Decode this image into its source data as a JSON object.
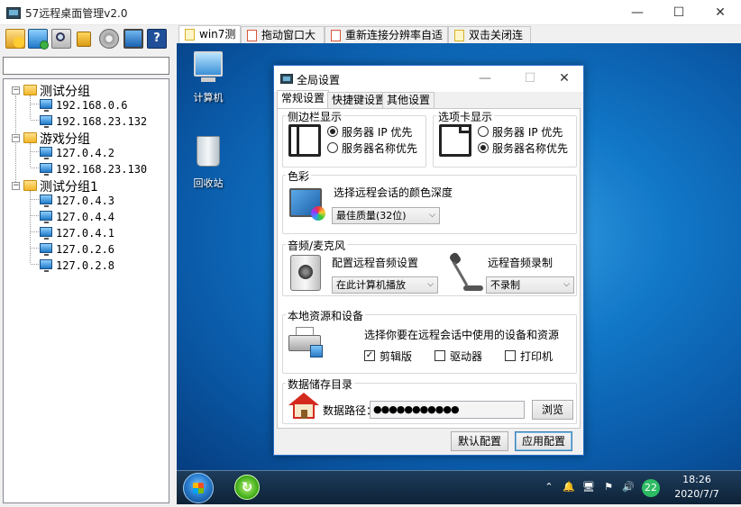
{
  "window": {
    "title": "57远程桌面管理v2.0",
    "min_glyph": "—",
    "max_glyph": "☐",
    "close_glyph": "✕"
  },
  "toolbar": {
    "icons": [
      "add-group-icon",
      "add-host-icon",
      "search-host-icon",
      "lock-icon",
      "settings-icon",
      "fullscreen-icon",
      "help-icon"
    ],
    "help_glyph": "?"
  },
  "search": {
    "value": ""
  },
  "tree": {
    "groups": [
      {
        "name": "测试分组",
        "hosts": [
          "192.168.0.6",
          "192.168.23.132"
        ]
      },
      {
        "name": "游戏分组",
        "hosts": [
          "127.0.4.2",
          "192.168.23.130"
        ]
      },
      {
        "name": "测试分组1",
        "hosts": [
          "127.0.4.3",
          "127.0.4.4",
          "127.0.4.1",
          "127.0.2.6",
          "127.0.2.8"
        ]
      }
    ],
    "expander_glyph": "−"
  },
  "tabs": [
    {
      "label": "win7测试",
      "active": true
    },
    {
      "label": "拖动窗口大小",
      "active": false
    },
    {
      "label": "重新连接分辨率自适应",
      "active": false
    },
    {
      "label": "双击关闭连接",
      "active": false
    }
  ],
  "desktop": {
    "icons": [
      {
        "label": "计算机",
        "icon": "computer-icon"
      },
      {
        "label": "回收站",
        "icon": "recycle-bin-icon"
      }
    ]
  },
  "taskbar": {
    "app_glyph": "↻",
    "tray_badge": "22",
    "time": "18:26",
    "date": "2020/7/7",
    "tray_icons": [
      "chevron-up-icon",
      "notification-icon",
      "network-icon",
      "flag-icon",
      "speaker-icon"
    ],
    "tray_glyphs": [
      "⌃",
      "🔔",
      "🖥",
      "⚑",
      "🔊"
    ]
  },
  "dialog": {
    "title": "全局设置",
    "min_glyph": "—",
    "max_glyph": "☐",
    "close_glyph": "✕",
    "tabs": [
      "常规设置",
      "快捷键设置",
      "其他设置"
    ],
    "sidebar": {
      "title": "侧边栏显示",
      "option_ip": "服务器 IP 优先",
      "option_name": "服务器名称优先",
      "selected": "option_ip"
    },
    "tabdisplay": {
      "title": "选项卡显示",
      "option_ip": "服务器 IP 优先",
      "option_name": "服务器名称优先",
      "selected": "option_name"
    },
    "color": {
      "title": "色彩",
      "label": "选择远程会话的颜色深度",
      "value": "最佳质量(32位)"
    },
    "audio": {
      "title": "音频/麦克风",
      "playback_label": "配置远程音频设置",
      "playback_value": "在此计算机播放",
      "record_label": "远程音频录制",
      "record_value": "不录制"
    },
    "local": {
      "title": "本地资源和设备",
      "label": "选择你要在远程会话中使用的设备和资源",
      "clipboard": "剪辑版",
      "clipboard_checked": true,
      "drives": "驱动器",
      "drives_checked": false,
      "printer": "打印机",
      "printer_checked": false,
      "check_glyph": "✓"
    },
    "storage": {
      "title": "数据储存目录",
      "path_label": "数据路径：",
      "path_value": "●●●●●●●●●●●",
      "browse": "浏览"
    },
    "buttons": {
      "default": "默认配置",
      "apply": "应用配置"
    }
  }
}
